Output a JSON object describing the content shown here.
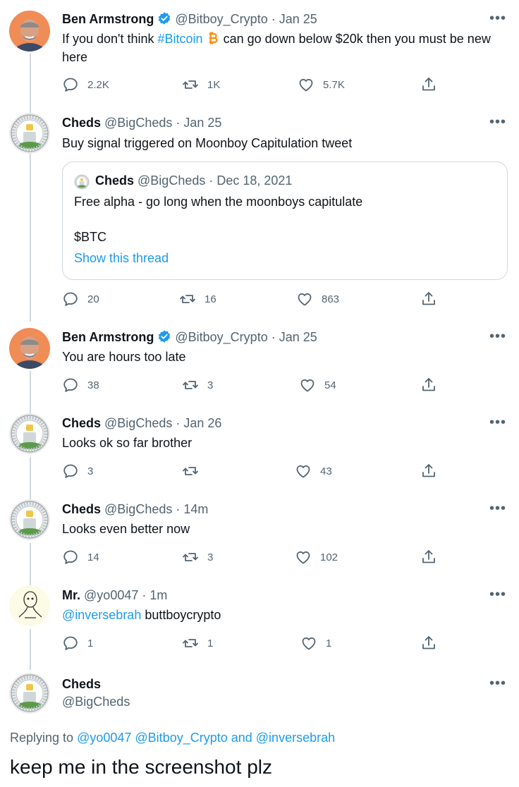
{
  "tweets": [
    {
      "name": "Ben Armstrong",
      "verified": true,
      "handle": "@Bitboy_Crypto",
      "time": "· Jan 25",
      "text_before": "If you don't think ",
      "hashtag": "#Bitcoin",
      "text_after": "  can go down below $20k then you must be new here",
      "replies": "2.2K",
      "retweets": "1K",
      "likes": "5.7K"
    },
    {
      "name": "Cheds",
      "handle": "@BigCheds",
      "time": "· Jan 25",
      "text": "Buy signal triggered on Moonboy Capitulation tweet",
      "quote": {
        "name": "Cheds",
        "handle": "@BigCheds",
        "time": "· Dec 18, 2021",
        "line1": "Free alpha - go long when the moonboys capitulate",
        "line2": "$BTC",
        "show_thread": "Show this thread"
      },
      "replies": "20",
      "retweets": "16",
      "likes": "863"
    },
    {
      "name": "Ben Armstrong",
      "verified": true,
      "handle": "@Bitboy_Crypto",
      "time": "· Jan 25",
      "text": "You are hours too late",
      "replies": "38",
      "retweets": "3",
      "likes": "54"
    },
    {
      "name": "Cheds",
      "handle": "@BigCheds",
      "time": "· Jan 26",
      "text": "Looks ok so far brother",
      "replies": "3",
      "retweets": "",
      "likes": "43"
    },
    {
      "name": "Cheds",
      "handle": "@BigCheds",
      "time": "· 14m",
      "text": "Looks even better now",
      "replies": "14",
      "retweets": "3",
      "likes": "102"
    },
    {
      "name": "Mr.",
      "handle": "@yo0047",
      "time": "· 1m",
      "mention": "@inversebrah",
      "text": " buttboycrypto",
      "replies": "1",
      "retweets": "1",
      "likes": "1"
    },
    {
      "name": "Cheds",
      "handle": "@BigCheds"
    }
  ],
  "more_glyph": "•••",
  "replying": {
    "prefix": "Replying to ",
    "user1": "@yo0047",
    "user2": "@Bitboy_Crypto",
    "and": " and ",
    "user3": "@inversebrah"
  },
  "caption": "keep me in the screenshot plz",
  "colors": {
    "link": "#1d9bf0",
    "secondary_text": "#536471",
    "border": "#cfd9de",
    "bitcoin": "#f7931a",
    "verified": "#1d9bf0"
  }
}
